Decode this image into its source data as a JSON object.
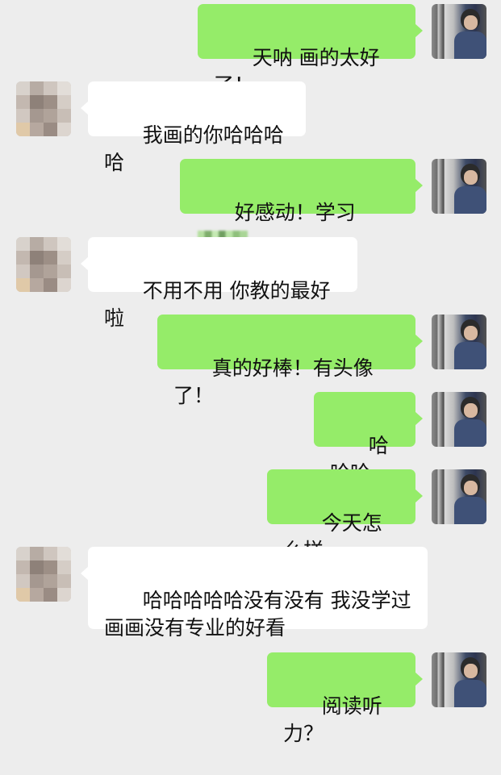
{
  "messages": [
    {
      "side": "me",
      "text": "天呐 画的太好了！"
    },
    {
      "side": "them",
      "text": "我画的你哈哈哈哈"
    },
    {
      "side": "me",
      "text": "好感动！学习",
      "redacted": true
    },
    {
      "side": "them",
      "text": "不用不用 你教的最好啦"
    },
    {
      "side": "me",
      "text": "真的好棒！有头像了！"
    },
    {
      "side": "me",
      "text": "哈哈哈"
    },
    {
      "side": "me",
      "text": "今天怎么样"
    },
    {
      "side": "them",
      "text": "哈哈哈哈哈没有没有 我没学过\n画画没有专业的好看"
    },
    {
      "side": "me",
      "text": "阅读听力？"
    }
  ],
  "colors": {
    "background": "#ededed",
    "outgoing_bubble": "#95ec69",
    "incoming_bubble": "#ffffff"
  },
  "icons": {
    "self_avatar": "user-photo-avatar",
    "contact_avatar": "pixelated-avatar"
  }
}
